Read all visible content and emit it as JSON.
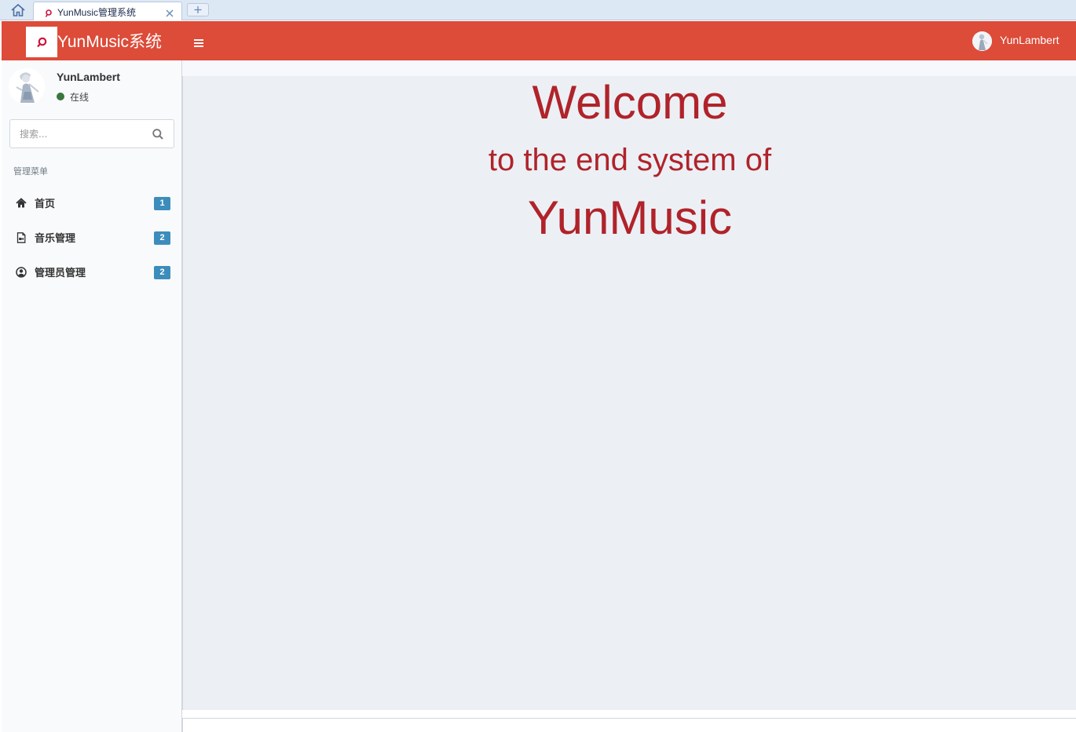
{
  "browser": {
    "tab_title": "YunMusic管理系统"
  },
  "header": {
    "brand": "YunMusic系统",
    "user_name": "YunLambert"
  },
  "sidebar": {
    "user_name": "YunLambert",
    "status": "在线",
    "search_placeholder": "搜索...",
    "menu_header": "管理菜单",
    "items": [
      {
        "label": "首页",
        "badge": "1",
        "icon": "home-icon"
      },
      {
        "label": "音乐管理",
        "badge": "2",
        "icon": "music-file-icon"
      },
      {
        "label": "管理员管理",
        "badge": "2",
        "icon": "user-circle-icon"
      }
    ]
  },
  "content": {
    "title": "Welcome",
    "subtitle": "to the end system of",
    "app_name": "YunMusic"
  },
  "colors": {
    "header": "#dd4b39",
    "welcome_text": "#b0232a",
    "badge": "#3c8dbc",
    "online": "#3c763d"
  }
}
